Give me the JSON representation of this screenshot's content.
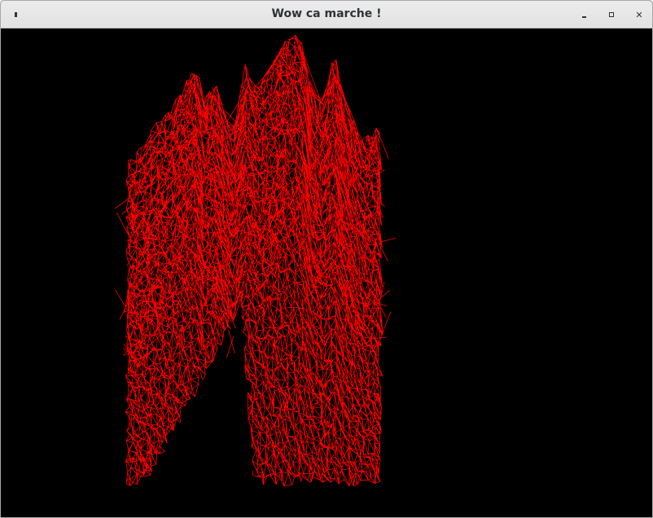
{
  "window": {
    "title": "Wow ca marche !"
  },
  "titlebar_buttons": {
    "menu_icon": "window-menu-icon",
    "minimize_icon": "minimize-icon",
    "maximize_icon": "maximize-icon",
    "close_icon": "close-icon",
    "close_glyph": "✕"
  },
  "canvas": {
    "background_color": "#000000",
    "wireframe_color": "#ff0000"
  }
}
